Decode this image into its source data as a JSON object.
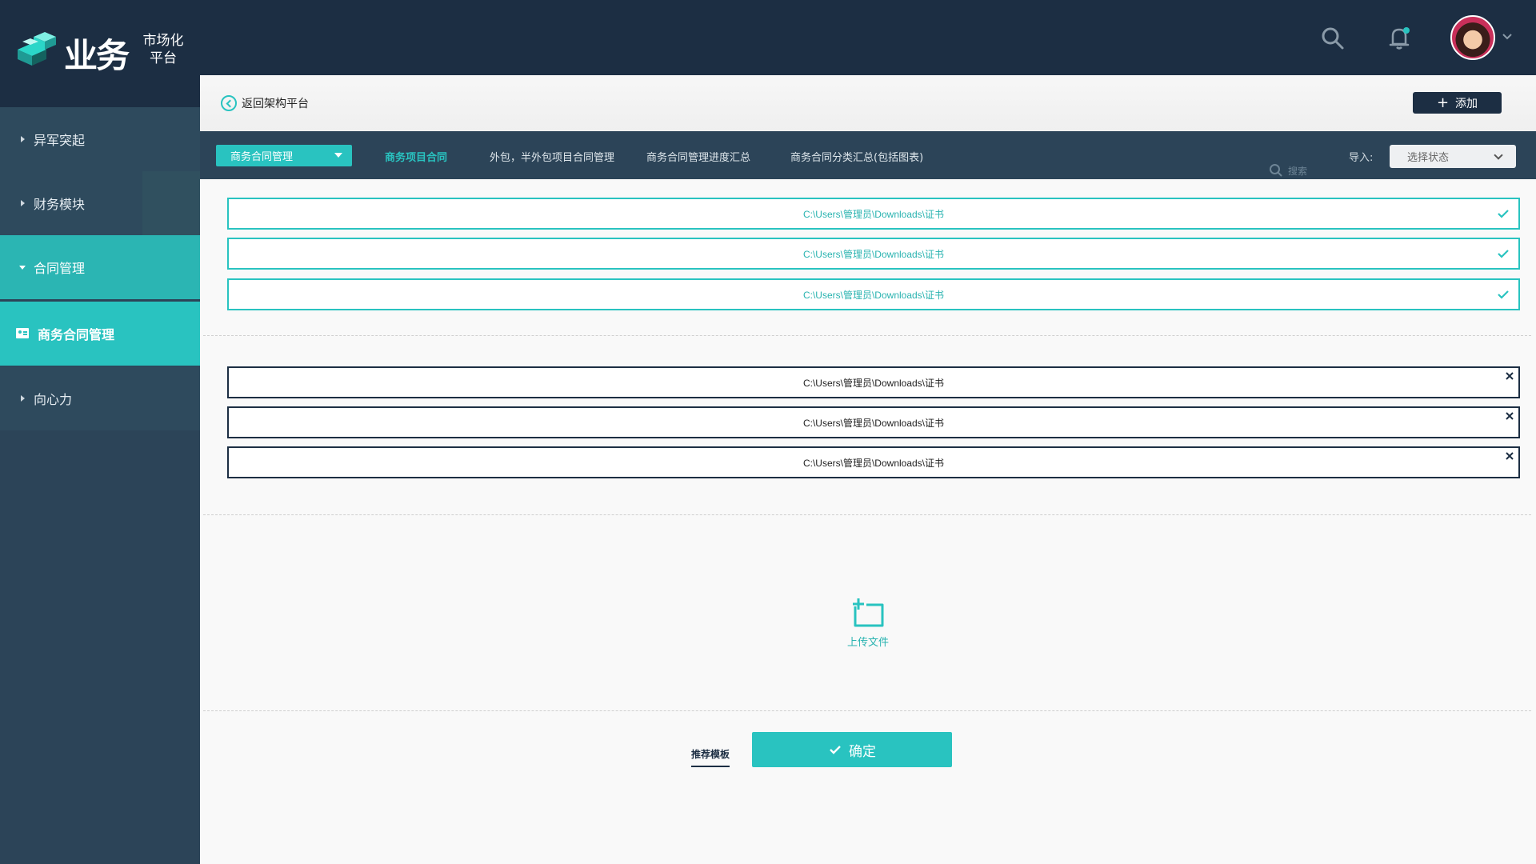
{
  "app": {
    "logo_text": "业务",
    "logo_sub_line1": "市场化",
    "logo_sub_line2": "平台"
  },
  "topbar": {
    "icons": [
      "search-icon",
      "bell-icon",
      "avatar",
      "chevron-down-icon"
    ],
    "notification_dot_color": "#29c3c0"
  },
  "sidebar": {
    "items": [
      {
        "label": "异军突起",
        "state": "collapsed"
      },
      {
        "label": "财务模块",
        "state": "collapsed"
      },
      {
        "label": "合同管理",
        "state": "expanded"
      },
      {
        "label": "商务合同管理",
        "state": "selected"
      },
      {
        "label": "向心力",
        "state": "collapsed"
      }
    ]
  },
  "header": {
    "back_label": "返回架构平台",
    "add_label": "添加"
  },
  "tabs": {
    "dropdown_label": "商务合同管理",
    "items": [
      {
        "label": "商务项目合同",
        "active": true
      },
      {
        "label": "外包，半外包项目合同管理",
        "active": false
      },
      {
        "label": "商务合同管理进度汇总",
        "active": false
      },
      {
        "label": "商务合同分类汇总(包括图表)",
        "active": false
      }
    ],
    "search_placeholder": "搜索",
    "import_label": "导入:",
    "status_select_value": "选择状态"
  },
  "files": {
    "success": [
      "C:\\Users\\管理员\\Downloads\\证书",
      "C:\\Users\\管理员\\Downloads\\证书",
      "C:\\Users\\管理员\\Downloads\\证书"
    ],
    "failed": [
      "C:\\Users\\管理员\\Downloads\\证书",
      "C:\\Users\\管理员\\Downloads\\证书",
      "C:\\Users\\管理员\\Downloads\\证书"
    ]
  },
  "upload": {
    "label": "上传文件"
  },
  "actions": {
    "template_label": "推荐模板",
    "confirm_label": "确定"
  },
  "colors": {
    "accent": "#29c3c0",
    "navy": "#1c2e43",
    "sidebar": "#2c4458"
  }
}
